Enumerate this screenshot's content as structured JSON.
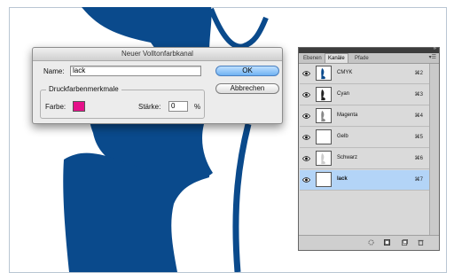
{
  "dialog": {
    "title": "Neuer Volltonfarbkanal",
    "name_label": "Name:",
    "name_value": "lack",
    "ok_label": "OK",
    "cancel_label": "Abbrechen",
    "group_title": "Druckfarbenmerkmale",
    "color_label": "Farbe:",
    "color_value": "#e5118a",
    "strength_label": "Stärke:",
    "strength_value": "0",
    "percent_label": "%"
  },
  "panel": {
    "tabs": [
      {
        "label": "Ebenen",
        "active": false
      },
      {
        "label": "Kanäle",
        "active": true
      },
      {
        "label": "Pfade",
        "active": false
      }
    ],
    "channels": [
      {
        "name": "CMYK",
        "shortcut": "⌘2",
        "selected": false,
        "icon": "cmyk-thumbnail"
      },
      {
        "name": "Cyan",
        "shortcut": "⌘3",
        "selected": false,
        "icon": "cyan-thumbnail"
      },
      {
        "name": "Magenta",
        "shortcut": "⌘4",
        "selected": false,
        "icon": "magenta-thumbnail"
      },
      {
        "name": "Gelb",
        "shortcut": "⌘5",
        "selected": false,
        "icon": "gelb-thumbnail"
      },
      {
        "name": "Schwarz",
        "shortcut": "⌘6",
        "selected": false,
        "icon": "schwarz-thumbnail"
      },
      {
        "name": "lack",
        "shortcut": "⌘7",
        "selected": true,
        "icon": "lack-thumbnail"
      }
    ]
  },
  "colors": {
    "artwork_blue": "#0a4a8c",
    "selection_blue": "#b3d4f7",
    "spot_magenta": "#e5118a"
  }
}
